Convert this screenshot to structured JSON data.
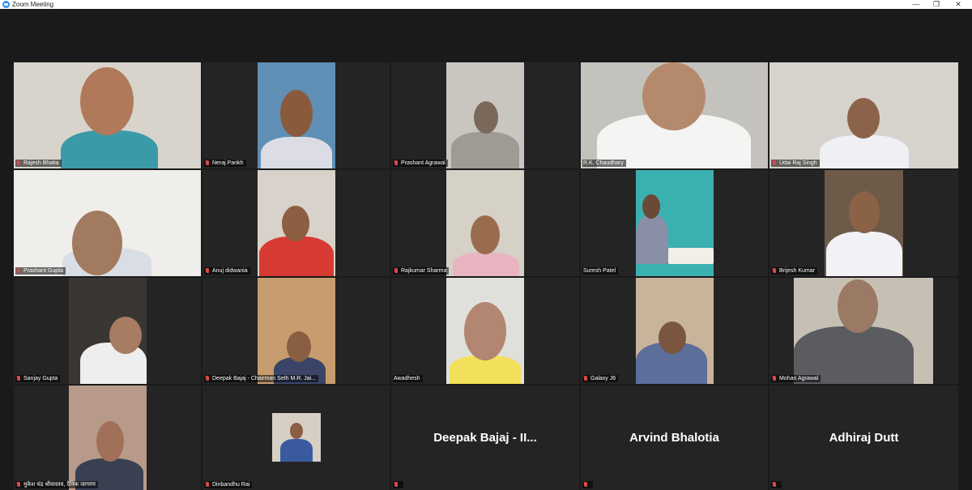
{
  "window": {
    "title": "Zoom Meeting",
    "app_icon": "zoom-logo-icon",
    "controls": [
      "minimize-icon",
      "restore-icon",
      "close-icon"
    ]
  },
  "participants": [
    {
      "name": "Rajesh Bhatia",
      "muted": true
    },
    {
      "name": "Neraj Parikh",
      "muted": true
    },
    {
      "name": "Prashant Agrawal",
      "muted": true
    },
    {
      "name": "R.K. Chaudhary",
      "muted": false,
      "active_speaker": true
    },
    {
      "name": "Udai Raj Singh",
      "muted": true
    },
    {
      "name": "Prashant Gupta",
      "muted": true
    },
    {
      "name": "Anuj didwania",
      "muted": true
    },
    {
      "name": "Rajkumar Sharma",
      "muted": true
    },
    {
      "name": "Suresh Patel",
      "muted": false
    },
    {
      "name": "Brijesh Kumar",
      "muted": true
    },
    {
      "name": "Sanjay Gupta",
      "muted": true
    },
    {
      "name": "Deepak Bajaj - Chairman Seth M.R. Jai...",
      "muted": true
    },
    {
      "name": "Awadhesh",
      "muted": false
    },
    {
      "name": "Galaxy J6",
      "muted": true
    },
    {
      "name": "Mohan Agrawal",
      "muted": true
    },
    {
      "name": "मुकेश चंद्र श्रीवास्तव, दैनिक जागरण",
      "muted": true
    },
    {
      "name": "Dinbandhu Rai",
      "muted": true
    },
    {
      "name": "Deepak Bajaj - II...",
      "muted": true,
      "video_off": true
    },
    {
      "name": "Arvind Bhalotia",
      "muted": true,
      "video_off": true
    },
    {
      "name": "Adhiraj Dutt",
      "muted": true,
      "video_off": true
    }
  ],
  "colors": {
    "background": "#1a1a1a",
    "tile": "#242424",
    "active_border": "#b7d44a",
    "muted_mic": "#e04848"
  }
}
